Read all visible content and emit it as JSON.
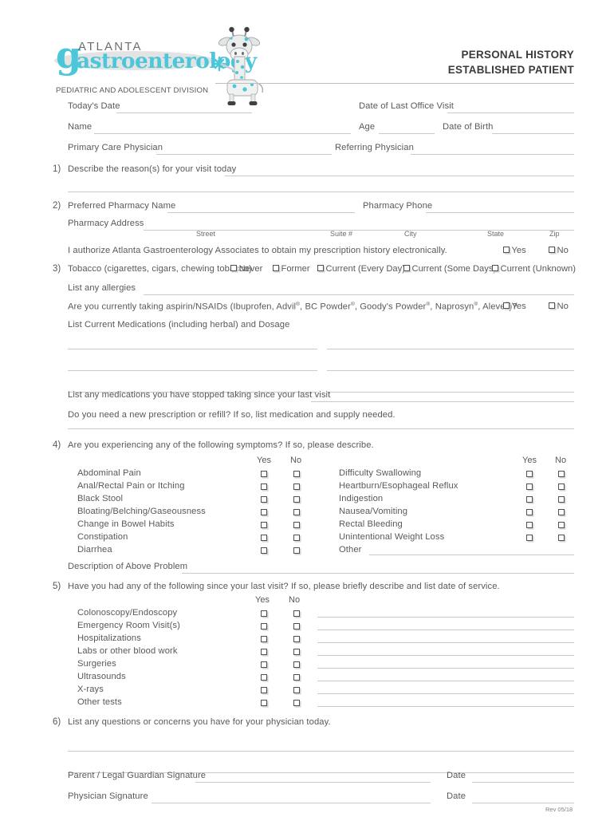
{
  "header": {
    "title_line1": "PERSONAL HISTORY",
    "title_line2": "ESTABLISHED PATIENT"
  },
  "logo": {
    "g_letter": "g",
    "atlanta": "ATLANTA",
    "gastroenterology": "astroenterology",
    "division": "PEDIATRIC AND ADOLESCENT DIVISION",
    "brand_color": "#4cc6d9",
    "mascot": "giraffe-mascot"
  },
  "patient_info": {
    "todays_date": "Today's Date",
    "date_of_last_office_visit": "Date of Last Office Visit",
    "name": "Name",
    "age": "Age",
    "date_of_birth": "Date of Birth",
    "primary_care_physician": "Primary Care Physician",
    "referring_physician": "Referring Physician"
  },
  "sections": {
    "q1": {
      "number": "1)",
      "label": "Describe the reason(s) for your visit today"
    },
    "q2": {
      "number": "2)",
      "pharmacy_name_label": "Preferred Pharmacy Name",
      "pharmacy_phone_label": "Pharmacy Phone",
      "pharmacy_address_label": "Pharmacy Address",
      "address_parts": [
        "Street",
        "Suite #",
        "City",
        "State",
        "Zip"
      ],
      "authorization_text": "I authorize Atlanta Gastroenterology Associates to obtain my prescription history electronically.",
      "authorization_options": [
        "Yes",
        "No"
      ]
    },
    "q3": {
      "number": "3)",
      "tobacco_label": "Tobacco (cigarettes, cigars, chewing tobacco)",
      "tobacco_options": [
        "Never",
        "Former",
        "Current (Every Day)",
        "Current (Some Days)",
        "Current (Unknown)"
      ],
      "allergies_label": "List any allergies",
      "nsaid_question": "Are you currently taking aspirin/NSAIDs (Ibuprofen, Advil®, BC Powder®, Goody's Powder®, Naprosyn®, Aleve®)?",
      "nsaid_options": [
        "Yes",
        "No"
      ],
      "current_meds_label": "List Current Medications (including herbal) and Dosage",
      "stopped_meds_label": "List any medications you have stopped taking since your last visit",
      "refill_label": "Do you need a new prescription or refill? If so, list medication and supply needed."
    },
    "q4": {
      "number": "4)",
      "label": "Are you experiencing any of the following symptoms?  If so, please describe.",
      "col_yes": "Yes",
      "col_no": "No",
      "symptoms_left": [
        "Abdominal Pain",
        "Anal/Rectal Pain or Itching",
        "Black Stool",
        "Bloating/Belching/Gaseousness",
        "Change in Bowel Habits",
        "Constipation",
        "Diarrhea"
      ],
      "symptoms_right": [
        "Difficulty Swallowing",
        "Heartburn/Esophageal Reflux",
        "Indigestion",
        "Nausea/Vomiting",
        "Rectal Bleeding",
        "Unintentional Weight Loss",
        "Other"
      ],
      "description_label": "Description of Above Problem"
    },
    "q5": {
      "number": "5)",
      "label": "Have you had any of the following since your last visit?  If so, please briefly describe and list date of service.",
      "col_yes": "Yes",
      "col_no": "No",
      "items": [
        "Colonoscopy/Endoscopy",
        "Emergency Room Visit(s)",
        "Hospitalizations",
        "Labs or other blood work",
        "Surgeries",
        "Ultrasounds",
        "X-rays",
        "Other tests"
      ]
    },
    "q6": {
      "number": "6)",
      "label": "List any questions or concerns you have for your physician today."
    }
  },
  "signature": {
    "guardian_label": "Parent / Legal Guardian Signature",
    "guardian_date_label": "Date",
    "physician_label": "Physician Signature",
    "physician_date_label": "Date"
  },
  "footer": {
    "revision": "Rev 05/18"
  }
}
